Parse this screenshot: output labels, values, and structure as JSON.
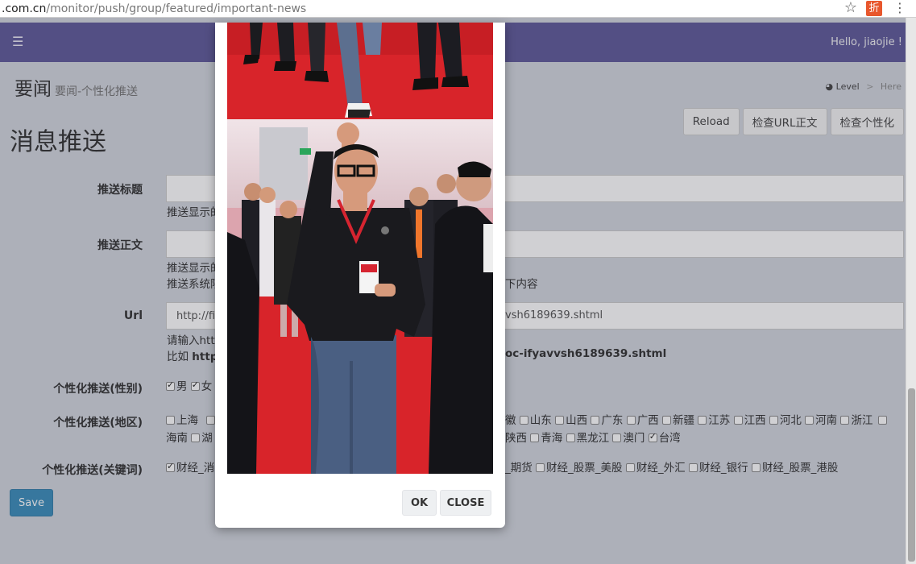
{
  "browser": {
    "url_host": ".com.cn",
    "url_path": "/monitor/push/group/featured/important-news",
    "ext_label": "折"
  },
  "topbar": {
    "greeting": "Hello, jiaojie !"
  },
  "header": {
    "title": "要闻",
    "subtitle": "要闻-个性化推送",
    "breadcrumb": {
      "level": "Level",
      "sep": ">",
      "here": "Here"
    }
  },
  "section_title": "消息推送",
  "toolbar": {
    "reload": "Reload",
    "check_url": "检查URL正文",
    "check_personal": "检查个性化"
  },
  "form": {
    "title_label": "推送标题",
    "title_help": "推送显示的",
    "body_label": "推送正文",
    "body_help1": "推送显示的",
    "body_help2_left": "推送系统限",
    "body_help2_right": "下内容",
    "url_label": "Url",
    "url_value_left": "http://fin",
    "url_value_right": "vsh6189639.shtml",
    "url_help1": "请输入http",
    "url_help2_prefix": "比如 ",
    "url_help2_left": "http:",
    "url_help2_right": "oc-ifyavvsh6189639.shtml",
    "gender_label": "个性化推送(性别)",
    "gender_options": [
      {
        "label": "男",
        "checked": true
      },
      {
        "label": "女",
        "checked": true
      }
    ],
    "region_label": "个性化推送(地区)",
    "region_row1_left": [
      {
        "label": "上海",
        "checked": false
      }
    ],
    "region_row1_right_prefix": "徽",
    "region_row1_right": [
      {
        "label": "山东",
        "checked": false
      },
      {
        "label": "山西",
        "checked": false
      },
      {
        "label": "广东",
        "checked": false
      },
      {
        "label": "广西",
        "checked": false
      },
      {
        "label": "新疆",
        "checked": false
      },
      {
        "label": "江苏",
        "checked": false
      },
      {
        "label": "江西",
        "checked": false
      },
      {
        "label": "河北",
        "checked": false
      },
      {
        "label": "河南",
        "checked": false
      },
      {
        "label": "浙江",
        "checked": false
      }
    ],
    "region_row2_left": [
      {
        "label": "海南",
        "checked": false
      },
      {
        "label": "湖",
        "checked": false
      }
    ],
    "region_row2_right": [
      {
        "label": "陕西",
        "checked": false
      },
      {
        "label": "青海",
        "checked": false
      },
      {
        "label": "黑龙江",
        "checked": false
      },
      {
        "label": "澳门",
        "checked": false
      },
      {
        "label": "台湾",
        "checked": true
      }
    ],
    "keyword_label": "个性化推送(关键词)",
    "keyword_left": [
      {
        "label": "财经_消",
        "checked": true
      }
    ],
    "keyword_right_prefix": "_期货",
    "keyword_right": [
      {
        "label": "财经_股票_美股",
        "checked": false
      },
      {
        "label": "财经_外汇",
        "checked": false
      },
      {
        "label": "财经_银行",
        "checked": false
      },
      {
        "label": "财经_股票_港股",
        "checked": false
      }
    ],
    "save": "Save"
  },
  "modal": {
    "ok": "OK",
    "close": "CLOSE"
  },
  "colors": {
    "topbar": "#5f5a9a",
    "save": "#3c8dbc",
    "carpet": "#d8242a"
  }
}
